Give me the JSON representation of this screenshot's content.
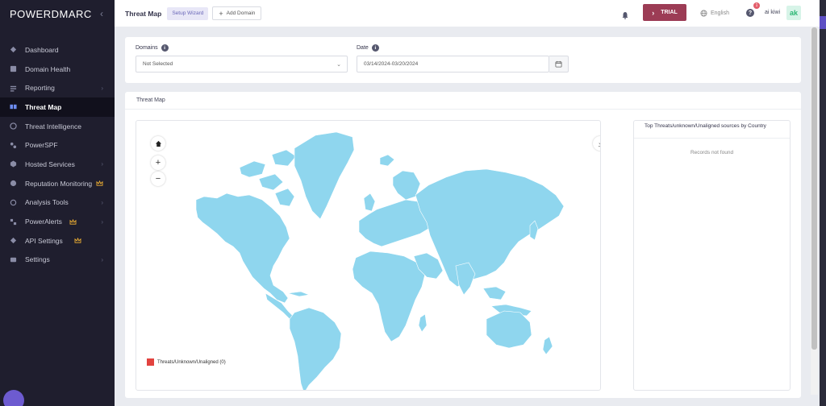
{
  "brand": {
    "name": "POWERDMARC",
    "collapse_icon": "chevron-left-icon"
  },
  "sidebar": {
    "items": [
      {
        "label": "Dashboard",
        "icon": "dashboard-icon",
        "has_chevron": false
      },
      {
        "label": "Domain Health",
        "icon": "domain-health-icon",
        "has_chevron": false
      },
      {
        "label": "Reporting",
        "icon": "reporting-icon",
        "has_chevron": true
      },
      {
        "label": "Threat Map",
        "icon": "threat-map-icon",
        "active": true
      },
      {
        "label": "Threat Intelligence",
        "icon": "threat-intelligence-icon",
        "has_chevron": false
      },
      {
        "label": "PowerSPF",
        "icon": "powerspf-icon",
        "has_chevron": false
      },
      {
        "label": "Hosted Services",
        "icon": "hosted-services-icon",
        "has_chevron": true
      },
      {
        "label": "Reputation Monitoring",
        "icon": "reputation-icon",
        "crown": true
      },
      {
        "label": "Analysis Tools",
        "icon": "analysis-tools-icon",
        "has_chevron": true
      },
      {
        "label": "PowerAlerts",
        "icon": "poweralerts-icon",
        "crown": true,
        "has_chevron": true
      },
      {
        "label": "API Settings",
        "icon": "api-settings-icon",
        "crown": true
      },
      {
        "label": "Settings",
        "icon": "settings-icon",
        "has_chevron": true
      }
    ]
  },
  "topbar": {
    "title": "Threat Map",
    "setup_wizard": "Setup Wizard",
    "add_domain": "Add Domain",
    "trial": "TRIAL",
    "language": "English",
    "help_badge": "1",
    "help": "?",
    "user_name": "ai kiwi",
    "avatar_initials": "ak"
  },
  "filters": {
    "domains_label": "Domains",
    "domains_value": "Not Selected",
    "date_label": "Date",
    "date_value": "03/14/2024-03/20/2024"
  },
  "map_card": {
    "title": "Threat Map",
    "legend_label": "Threats/Unknown/Unaligned (0)",
    "side_title": "Top Threats/unknown/Unaligned sources by Country",
    "side_empty": "Records not found"
  },
  "colors": {
    "sidebar_bg": "#1f1e2e",
    "accent_trial": "#9c3c55",
    "map_land": "#8fd6ee",
    "threat": "#e2433f"
  }
}
